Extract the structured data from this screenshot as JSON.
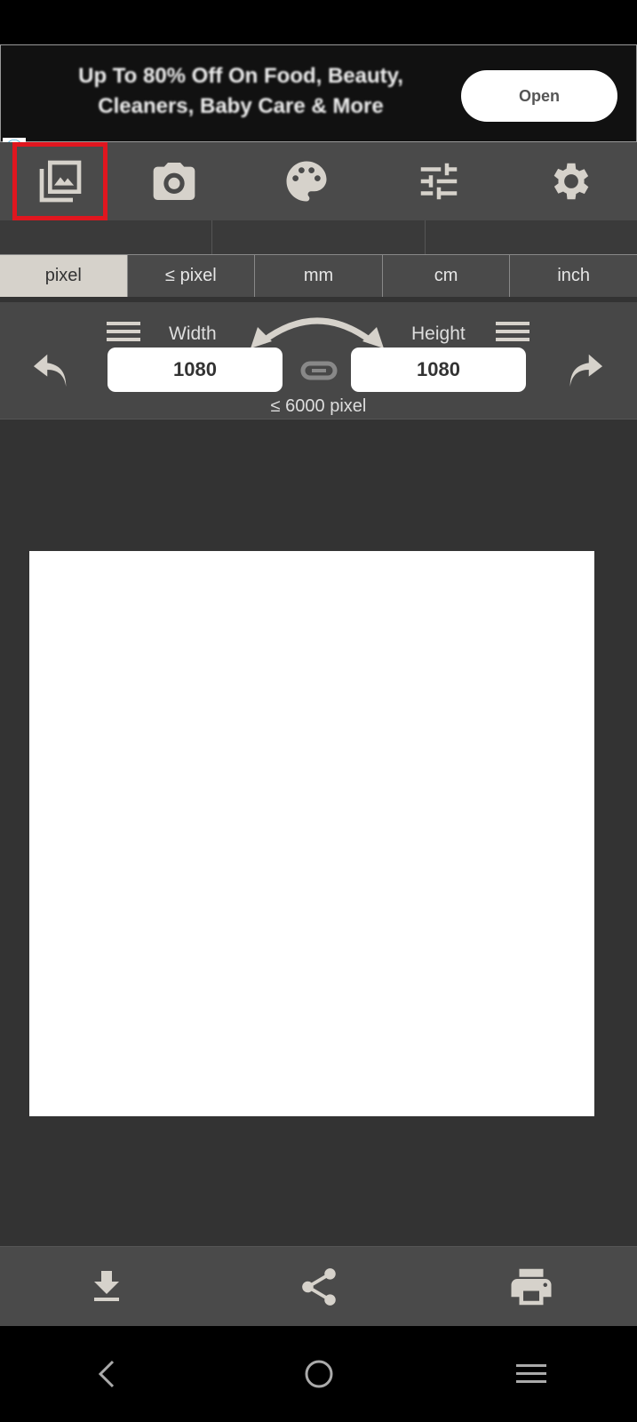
{
  "ad": {
    "text": "Up To 80% Off On Food, Beauty, Cleaners, Baby Care & More",
    "button": "Open",
    "info_icon": "info-icon",
    "close_icon": "close-icon"
  },
  "toolbar": {
    "items": [
      {
        "icon": "gallery-icon",
        "selected": true,
        "highlight_color": "#e0161f"
      },
      {
        "icon": "camera-icon"
      },
      {
        "icon": "palette-icon"
      },
      {
        "icon": "sliders-icon"
      },
      {
        "icon": "gear-icon"
      }
    ]
  },
  "units": {
    "items": [
      "pixel",
      "≤ pixel",
      "mm",
      "cm",
      "inch"
    ],
    "selected": "pixel"
  },
  "size": {
    "width_label": "Width",
    "height_label": "Height",
    "width_value": "1080",
    "height_value": "1080",
    "limit": "≤ 6000 pixel"
  },
  "bottom": {
    "items": [
      "download-icon",
      "share-icon",
      "print-icon"
    ]
  },
  "nav": {
    "items": [
      "back-icon",
      "home-icon",
      "recents-icon"
    ]
  },
  "colors": {
    "accent": "#d6d2cb",
    "toolbar": "#4a4a4a",
    "background": "#333333"
  }
}
